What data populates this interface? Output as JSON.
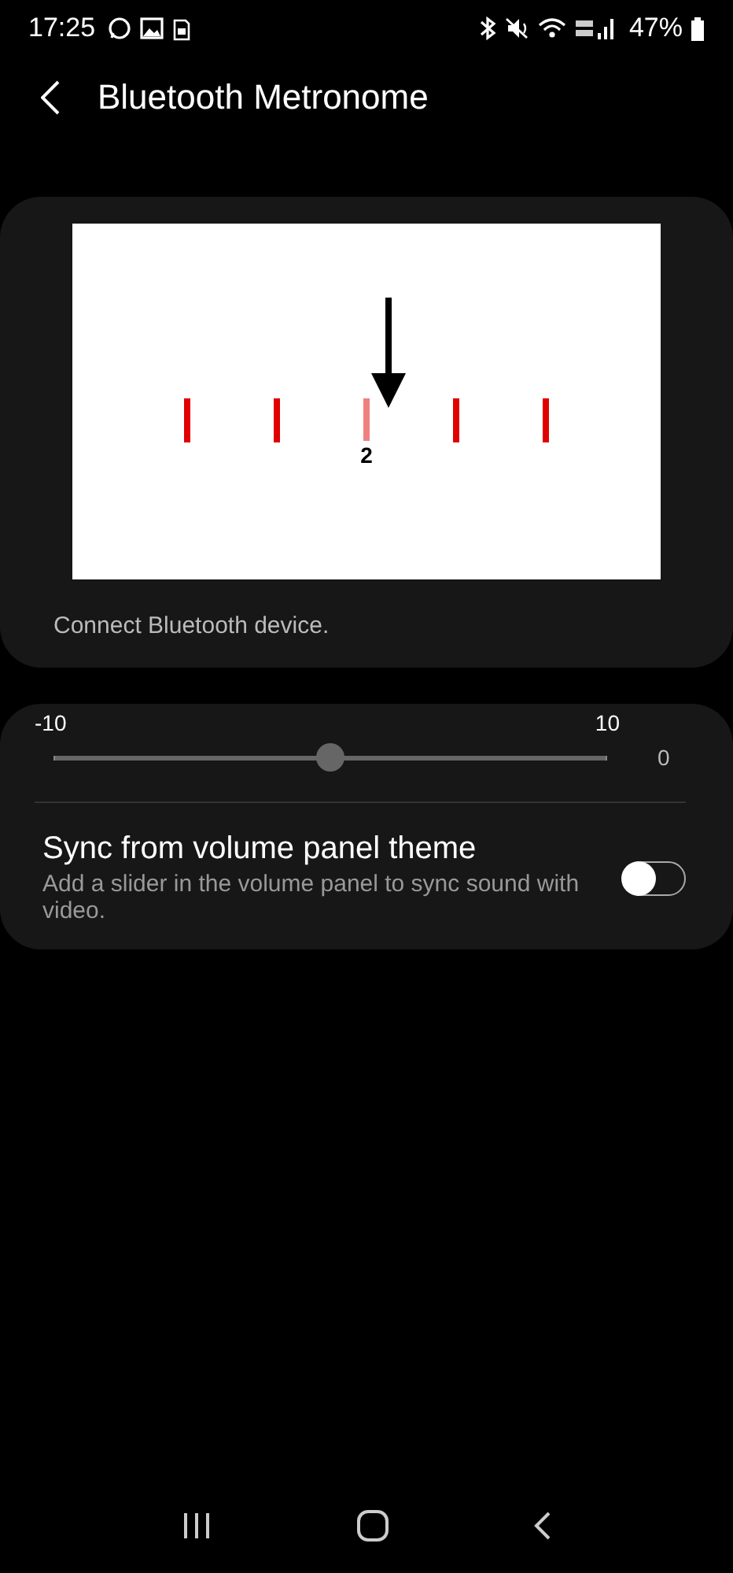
{
  "status_bar": {
    "time": "17:25",
    "battery": "47%"
  },
  "header": {
    "title": "Bluetooth Metronome"
  },
  "preview": {
    "ticks": [
      {
        "selected": false
      },
      {
        "selected": false
      },
      {
        "selected": true
      },
      {
        "selected": false
      },
      {
        "selected": false
      }
    ],
    "beat_label": "2",
    "caption": "Connect Bluetooth device."
  },
  "offset_slider": {
    "min_label": "-10",
    "max_label": "10",
    "level": 0.5,
    "reading": "0"
  },
  "sync_setting": {
    "title": "Sync from volume panel theme",
    "description": "Add a slider in the volume panel to sync sound with video.",
    "on": false
  }
}
